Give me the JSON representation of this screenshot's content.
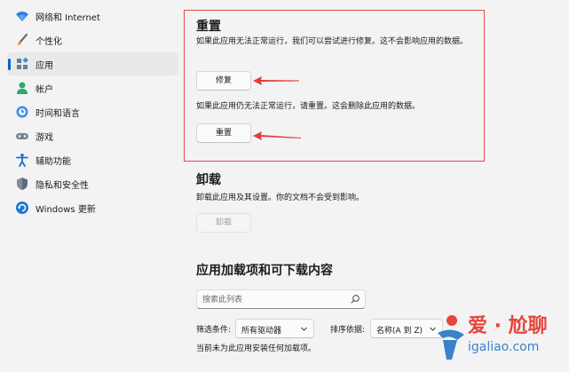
{
  "sidebar": {
    "items": [
      {
        "label": "网络和 Internet",
        "icon": "wifi-icon"
      },
      {
        "label": "个性化",
        "icon": "paintbrush-icon"
      },
      {
        "label": "应用",
        "icon": "apps-icon",
        "selected": true
      },
      {
        "label": "帐户",
        "icon": "account-icon"
      },
      {
        "label": "时间和语言",
        "icon": "time-language-icon"
      },
      {
        "label": "游戏",
        "icon": "gamepad-icon"
      },
      {
        "label": "辅助功能",
        "icon": "accessibility-icon"
      },
      {
        "label": "隐私和安全性",
        "icon": "shield-icon"
      },
      {
        "label": "Windows 更新",
        "icon": "windows-update-icon"
      }
    ]
  },
  "reset_section": {
    "title": "重置",
    "repair_desc": "如果此应用无法正常运行，我们可以尝试进行修复。这不会影响应用的数据。",
    "repair_button": "修复",
    "reset_desc": "如果此应用仍无法正常运行，请重置。这会删除此应用的数据。",
    "reset_button": "重置"
  },
  "uninstall_section": {
    "title": "卸载",
    "desc": "卸载此应用及其设置。你的文档不会受到影响。",
    "uninstall_button": "卸载"
  },
  "addons_section": {
    "title": "应用加载项和可下载内容",
    "search_placeholder": "搜索此列表",
    "filter_label": "筛选条件:",
    "filter_value": "所有驱动器",
    "sort_label": "排序依据:",
    "sort_value": "名称(A 到 Z)",
    "empty_message": "当前未为此应用安装任何加载项。"
  },
  "watermark": {
    "text_cn": "爱 · 尬聊",
    "text_url": "igaliao.com"
  },
  "colors": {
    "accent": "#0067c0",
    "highlight_border": "#e5484d",
    "arrow": "#e23b3b",
    "background": "#f3f3f3"
  }
}
